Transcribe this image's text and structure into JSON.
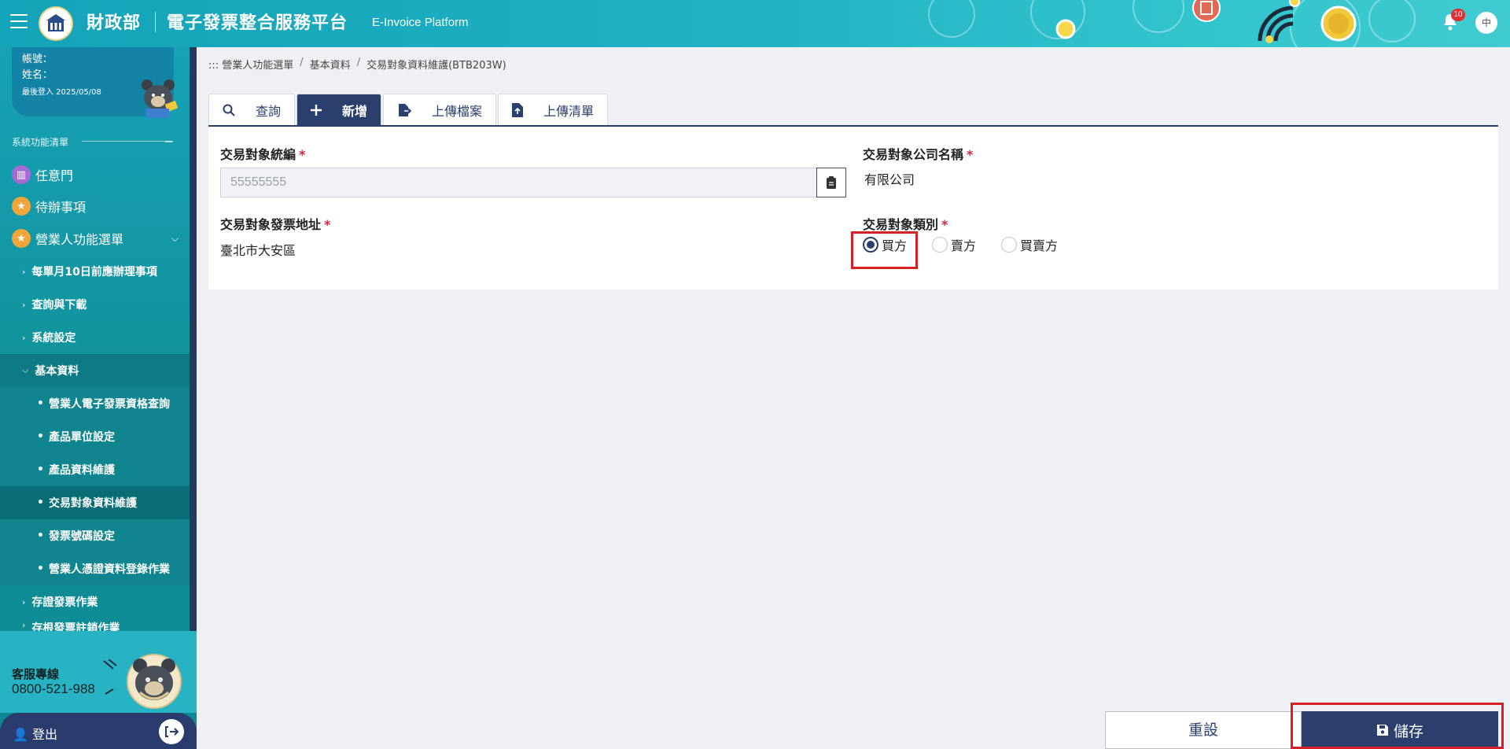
{
  "header": {
    "ministry": "財政部",
    "platform": "電子發票整合服務平台",
    "platform_en": "E-Invoice Platform",
    "notification_count": "10",
    "lang": "中"
  },
  "user": {
    "account_label": "帳號：",
    "name_label": "姓名：",
    "last_login": "最後登入 2025/05/08"
  },
  "sidebar": {
    "heading": "系統功能清單",
    "top_items": [
      {
        "label": "任意門",
        "color": "#a56ad6"
      },
      {
        "label": "待辦事項",
        "color": "#f0a63a"
      },
      {
        "label": "營業人功能選單",
        "color": "#f0a63a"
      }
    ],
    "sub_items": [
      {
        "label": "每單月10日前應辦理事項"
      },
      {
        "label": "查詢與下載"
      },
      {
        "label": "系統設定"
      },
      {
        "label": "基本資料"
      }
    ],
    "leaves": [
      {
        "label": "營業人電子發票資格查詢"
      },
      {
        "label": "產品單位設定"
      },
      {
        "label": "產品資料維護"
      },
      {
        "label": "交易對象資料維護"
      },
      {
        "label": "發票號碼設定"
      },
      {
        "label": "營業人憑證資料登錄作業"
      }
    ],
    "more_items": [
      {
        "label": "存證發票作業"
      },
      {
        "label": "存根發票註銷作業"
      }
    ],
    "support_label": "客服專線",
    "support_phone": "0800-521-988",
    "logout": "登出"
  },
  "breadcrumb": [
    "::: 營業人功能選單",
    "基本資料",
    "交易對象資料維護(BTB203W)"
  ],
  "tabs": [
    {
      "label": "查詢"
    },
    {
      "label": "新增"
    },
    {
      "label": "上傳檔案"
    },
    {
      "label": "上傳清單"
    }
  ],
  "form": {
    "tax_id_label": "交易對象統編",
    "tax_id_value": "55555555",
    "company_label": "交易對象公司名稱",
    "company_value": "有限公司",
    "address_label": "交易對象發票地址",
    "address_value": "臺北市大安區",
    "type_label": "交易對象類別",
    "types": [
      "買方",
      "賣方",
      "買賣方"
    ],
    "selected_type": "買方",
    "required_mark": "*"
  },
  "actions": {
    "reset": "重設",
    "save": "儲存"
  },
  "colors": {
    "primary": "#2b3f6e",
    "teal": "#17a2b6",
    "required": "#d7263d",
    "highlight": "#d61f26"
  }
}
